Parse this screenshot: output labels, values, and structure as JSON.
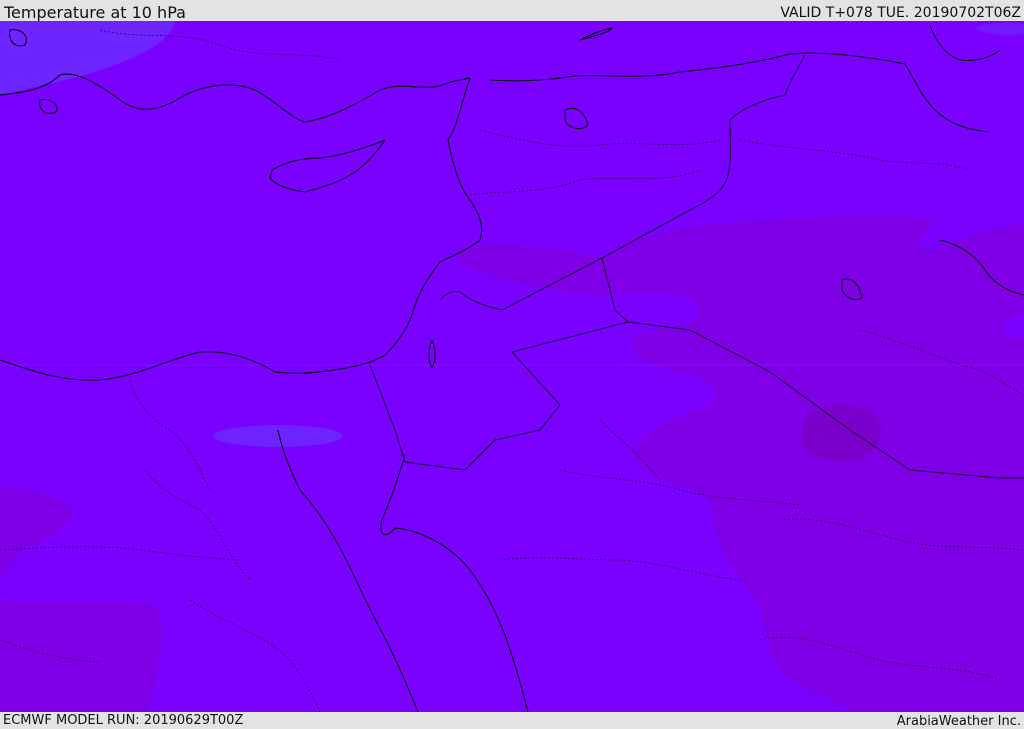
{
  "header": {
    "title": "Temperature at 10 hPa",
    "valid_time": "VALID T+078 TUE. 20190702T06Z"
  },
  "footer": {
    "model_run": "ECMWF MODEL RUN: 20190629T00Z",
    "credit": "ArabiaWeather Inc."
  },
  "colors": {
    "field_base": "#7a00ff",
    "field_warm": "#7f00e6",
    "field_cool": "#6a2cff",
    "coastline": "#000000",
    "border": "#3a0a6a",
    "panel_bg": "#e3e3e3"
  }
}
